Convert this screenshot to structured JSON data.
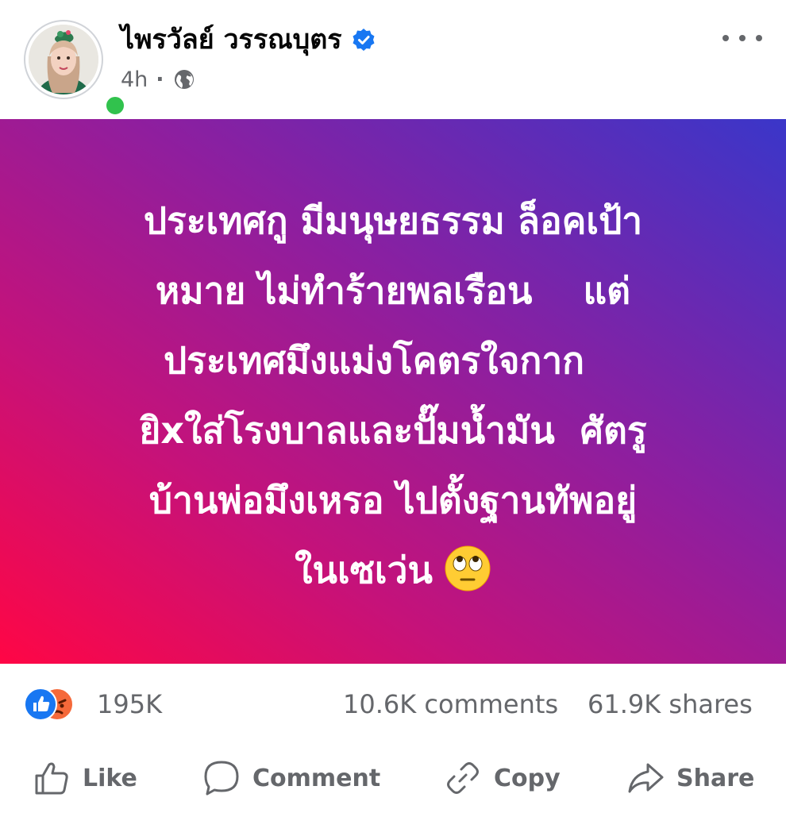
{
  "author": {
    "name": "ไพรวัลย์ วรรณบุตร",
    "verified": true,
    "online": true,
    "avatar_icon": "profile-photo"
  },
  "post_meta": {
    "time": "4h",
    "separator": "·",
    "audience_icon": "globe-icon"
  },
  "post_text": {
    "lines": [
      "ประเทศกู มีมนุษยธรรม ล็อคเป้า",
      "หมาย ไม่ทำร้ายพลเรือน    แต่",
      "ประเทศมึงแม่งโคตรใจกาก   ",
      "ยิxใส่โรงบาลและปั๊มน้ำมัน  ศัตรู",
      "บ้านพ่อมึงเหรอ ไปตั้งฐานทัพอยู่",
      "ในเซเว่น"
    ],
    "emoji": "face-with-rolling-eyes",
    "background_colors": [
      "#ff0645",
      "#c5127a",
      "#8c1fa0",
      "#3a36c9"
    ]
  },
  "stats": {
    "reactions": [
      "like",
      "angry"
    ],
    "reaction_count": "195K",
    "comments": "10.6K comments",
    "shares": "61.9K shares"
  },
  "actions": {
    "like": "Like",
    "comment": "Comment",
    "copy": "Copy",
    "share": "Share"
  },
  "colors": {
    "verified_blue": "#1877f2",
    "online_green": "#31c24d",
    "secondary_text": "#65676b",
    "like_blue": "#1877f2",
    "angry_orange": "#f5693a"
  }
}
